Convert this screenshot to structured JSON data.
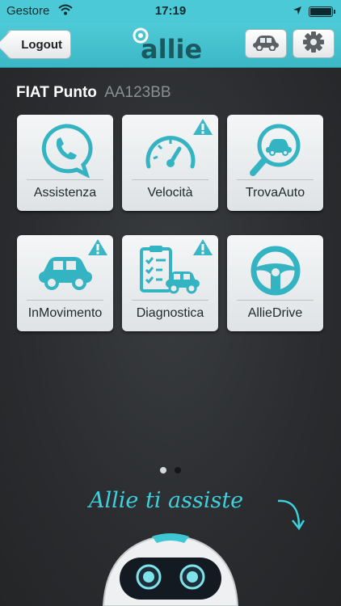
{
  "statusbar": {
    "carrier": "Gestore",
    "time": "17:19"
  },
  "navbar": {
    "logout_label": "Logout",
    "logo_text": "allie",
    "car_icon": "car-icon",
    "settings_icon": "gear-icon"
  },
  "vehicle": {
    "model": "FIAT Punto",
    "plate": "AA123BB"
  },
  "tiles": [
    {
      "label": "Assistenza",
      "icon": "phone-chat-icon",
      "warning": false
    },
    {
      "label": "Velocità",
      "icon": "speedometer-icon",
      "warning": true
    },
    {
      "label": "TrovaAuto",
      "icon": "car-search-icon",
      "warning": false
    },
    {
      "label": "InMovimento",
      "icon": "car-icon",
      "warning": true
    },
    {
      "label": "Diagnostica",
      "icon": "checklist-car-icon",
      "warning": true
    },
    {
      "label": "AllieDrive",
      "icon": "steering-wheel-icon",
      "warning": false
    }
  ],
  "pager": {
    "pages": 2,
    "current": 1
  },
  "footer": {
    "tagline": "Allie ti assiste"
  },
  "colors": {
    "accent": "#3ed0dc",
    "navbar": "#4bc9d6",
    "background": "#2b2d30",
    "warning": "#3ab6c4"
  }
}
